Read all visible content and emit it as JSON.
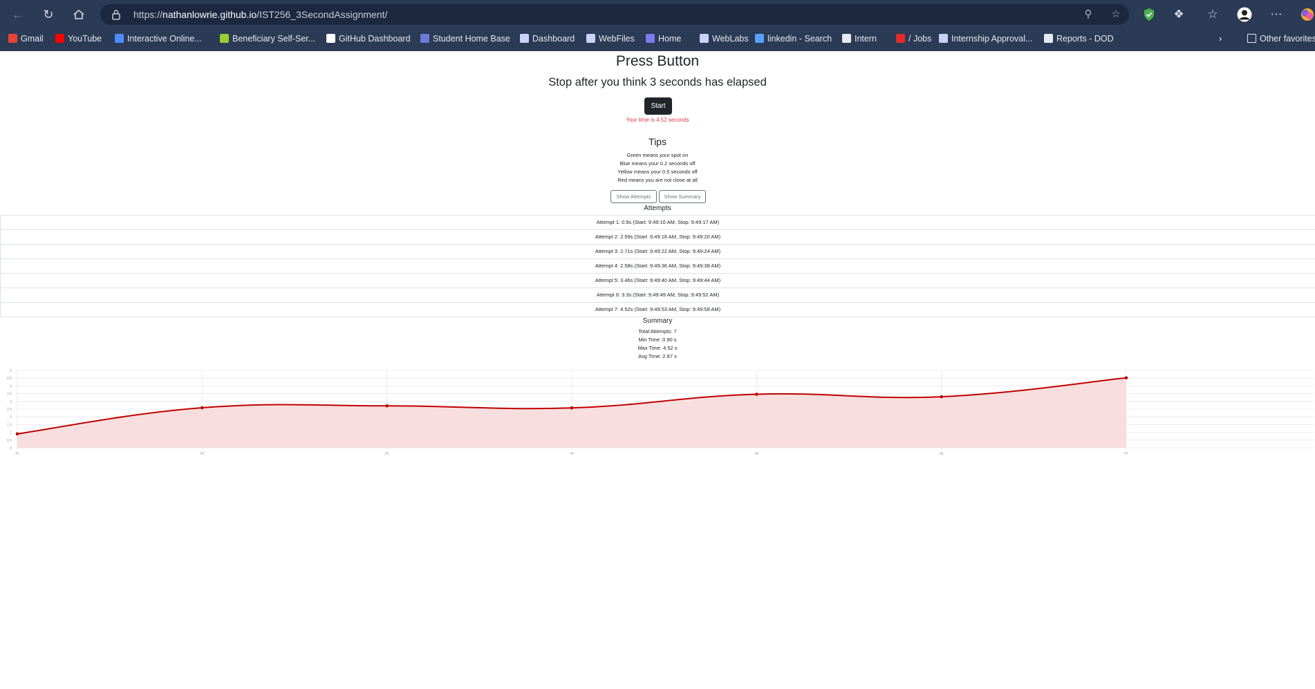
{
  "browser": {
    "url_prefix": "https://",
    "url_host": "nathanlowrie.github.io",
    "url_path": "/IST256_3SecondAssignment/",
    "bookmarks": [
      {
        "label": "Gmail",
        "color": "#ea4335"
      },
      {
        "label": "YouTube",
        "color": "#ff0000"
      },
      {
        "label": "Interactive Online...",
        "color": "#4f8cff"
      },
      {
        "label": "Beneficiary Self-Ser...",
        "color": "#9acd32"
      },
      {
        "label": "GitHub Dashboard",
        "color": "#ffffff"
      },
      {
        "label": "Student Home Base",
        "color": "#6f7bd9"
      },
      {
        "label": "Dashboard",
        "color": "#c9d2ff"
      },
      {
        "label": "WebFiles",
        "color": "#c9d2ff"
      },
      {
        "label": "Home",
        "color": "#7b7cf0"
      },
      {
        "label": "WebLabs",
        "color": "#c9d2ff"
      },
      {
        "label": "linkedin - Search",
        "color": "#5aa0ff"
      },
      {
        "label": "Intern",
        "color": "#e6eaf1"
      },
      {
        "label": "/ Jobs",
        "color": "#e52b2b"
      },
      {
        "label": "Internship Approval...",
        "color": "#c9d2ff"
      },
      {
        "label": "Reports - DOD",
        "color": "#e6eaf1"
      }
    ],
    "other_favorites": "Other favorites"
  },
  "page": {
    "title": "Press Button",
    "subtitle": "Stop after you think 3 seconds has elapsed",
    "start_label": "Start",
    "time_result": "Your time is 4.52 seconds",
    "tips_title": "Tips",
    "tips": [
      "Green means your spot on",
      "Blue means your 0.2 seconds off",
      "Yellow means your 0.5 seconds off",
      "Red means you are not close at all"
    ],
    "show_attempts_label": "Show Attempts",
    "show_summary_label": "Show Summary",
    "attempts_title": "Attempts",
    "attempts": [
      "Attempt 1: 0.9s (Start: 9:49:16 AM, Stop: 9:49:17 AM)",
      "Attempt 2: 2.59s (Start: 9:49:18 AM, Stop: 9:49:20 AM)",
      "Attempt 3: 2.71s (Start: 9:49:22 AM, Stop: 9:49:24 AM)",
      "Attempt 4: 2.58s (Start: 9:49:36 AM, Stop: 9:49:38 AM)",
      "Attempt 5: 3.46s (Start: 9:49:40 AM, Stop: 9:49:44 AM)",
      "Attempt 6: 3.3s (Start: 9:49:49 AM, Stop: 9:49:52 AM)",
      "Attempt 7: 4.52s (Start: 9:49:53 AM, Stop: 9:49:58 AM)"
    ],
    "summary_title": "Summary",
    "summary": [
      "Total Attempts: 7",
      "Min Time: 0.90 s",
      "Max Time: 4.52 s",
      "Avg Time: 2.87 s"
    ]
  },
  "chart_data": {
    "type": "area",
    "categories": [
      "#1",
      "#2",
      "#3",
      "#4",
      "#5",
      "#6",
      "#7"
    ],
    "values": [
      0.9,
      2.59,
      2.71,
      2.58,
      3.46,
      3.3,
      4.52
    ],
    "ylim": [
      0,
      5
    ],
    "yticks": [
      "0",
      "0.5",
      "1",
      "1.5",
      "2",
      "2.5",
      "3",
      "3.5",
      "4",
      "4.5",
      "5"
    ],
    "grid": true,
    "line_color": "#c00000",
    "fill_color": "#f8dede"
  }
}
